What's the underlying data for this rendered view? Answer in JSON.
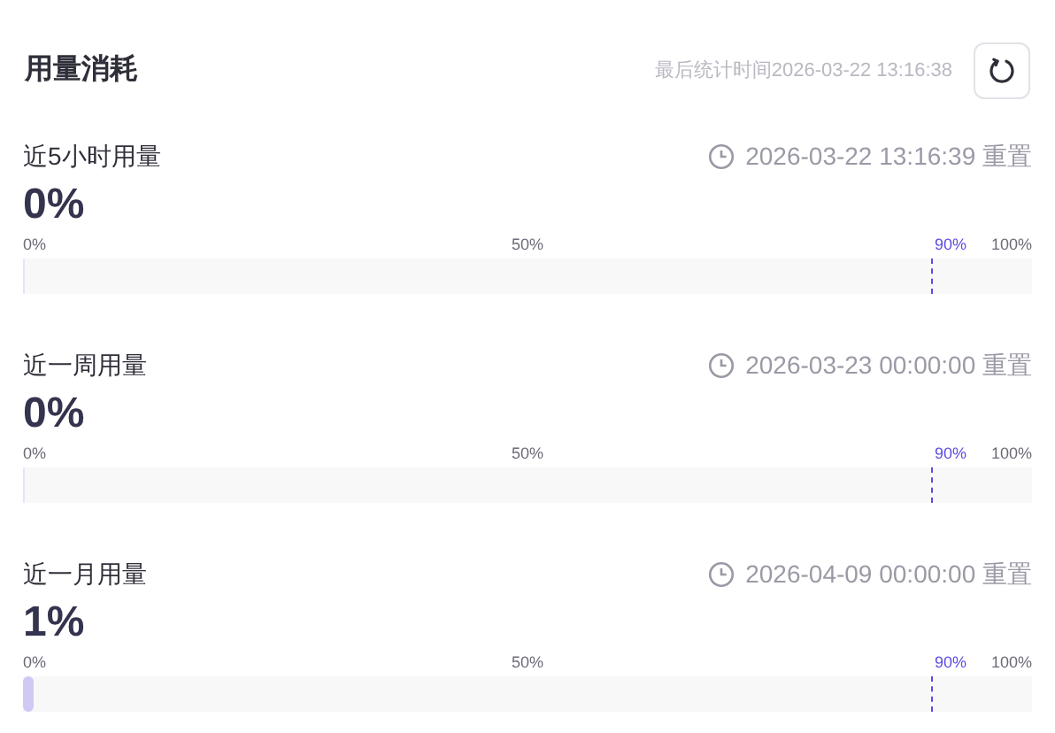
{
  "header": {
    "title": "用量消耗",
    "last_updated": "最后统计时间2026-03-22 13:16:38"
  },
  "usages": [
    {
      "label": "近5小时用量",
      "reset_time": "2026-03-22 13:16:39 重置",
      "percent": "0%",
      "level": 0,
      "ticks": [
        {
          "text": "0%",
          "kind": "scale"
        },
        {
          "text": "50%",
          "kind": "scale"
        },
        {
          "text": "90%",
          "kind": "threshold"
        },
        {
          "text": "100%",
          "kind": "scale"
        }
      ]
    },
    {
      "label": "近一周用量",
      "reset_time": "2026-03-23 00:00:00 重置",
      "percent": "0%",
      "level": 0,
      "ticks": [
        {
          "text": "0%",
          "kind": "scale"
        },
        {
          "text": "50%",
          "kind": "scale"
        },
        {
          "text": "90%",
          "kind": "threshold"
        },
        {
          "text": "100%",
          "kind": "scale"
        }
      ]
    },
    {
      "label": "近一月用量",
      "reset_time": "2026-04-09 00:00:00 重置",
      "percent": "1%",
      "level": 0.01,
      "ticks": [
        {
          "text": "0%",
          "kind": "scale"
        },
        {
          "text": "50%",
          "kind": "scale"
        },
        {
          "text": "90%",
          "kind": "threshold"
        },
        {
          "text": "100%",
          "kind": "scale"
        }
      ]
    }
  ]
}
